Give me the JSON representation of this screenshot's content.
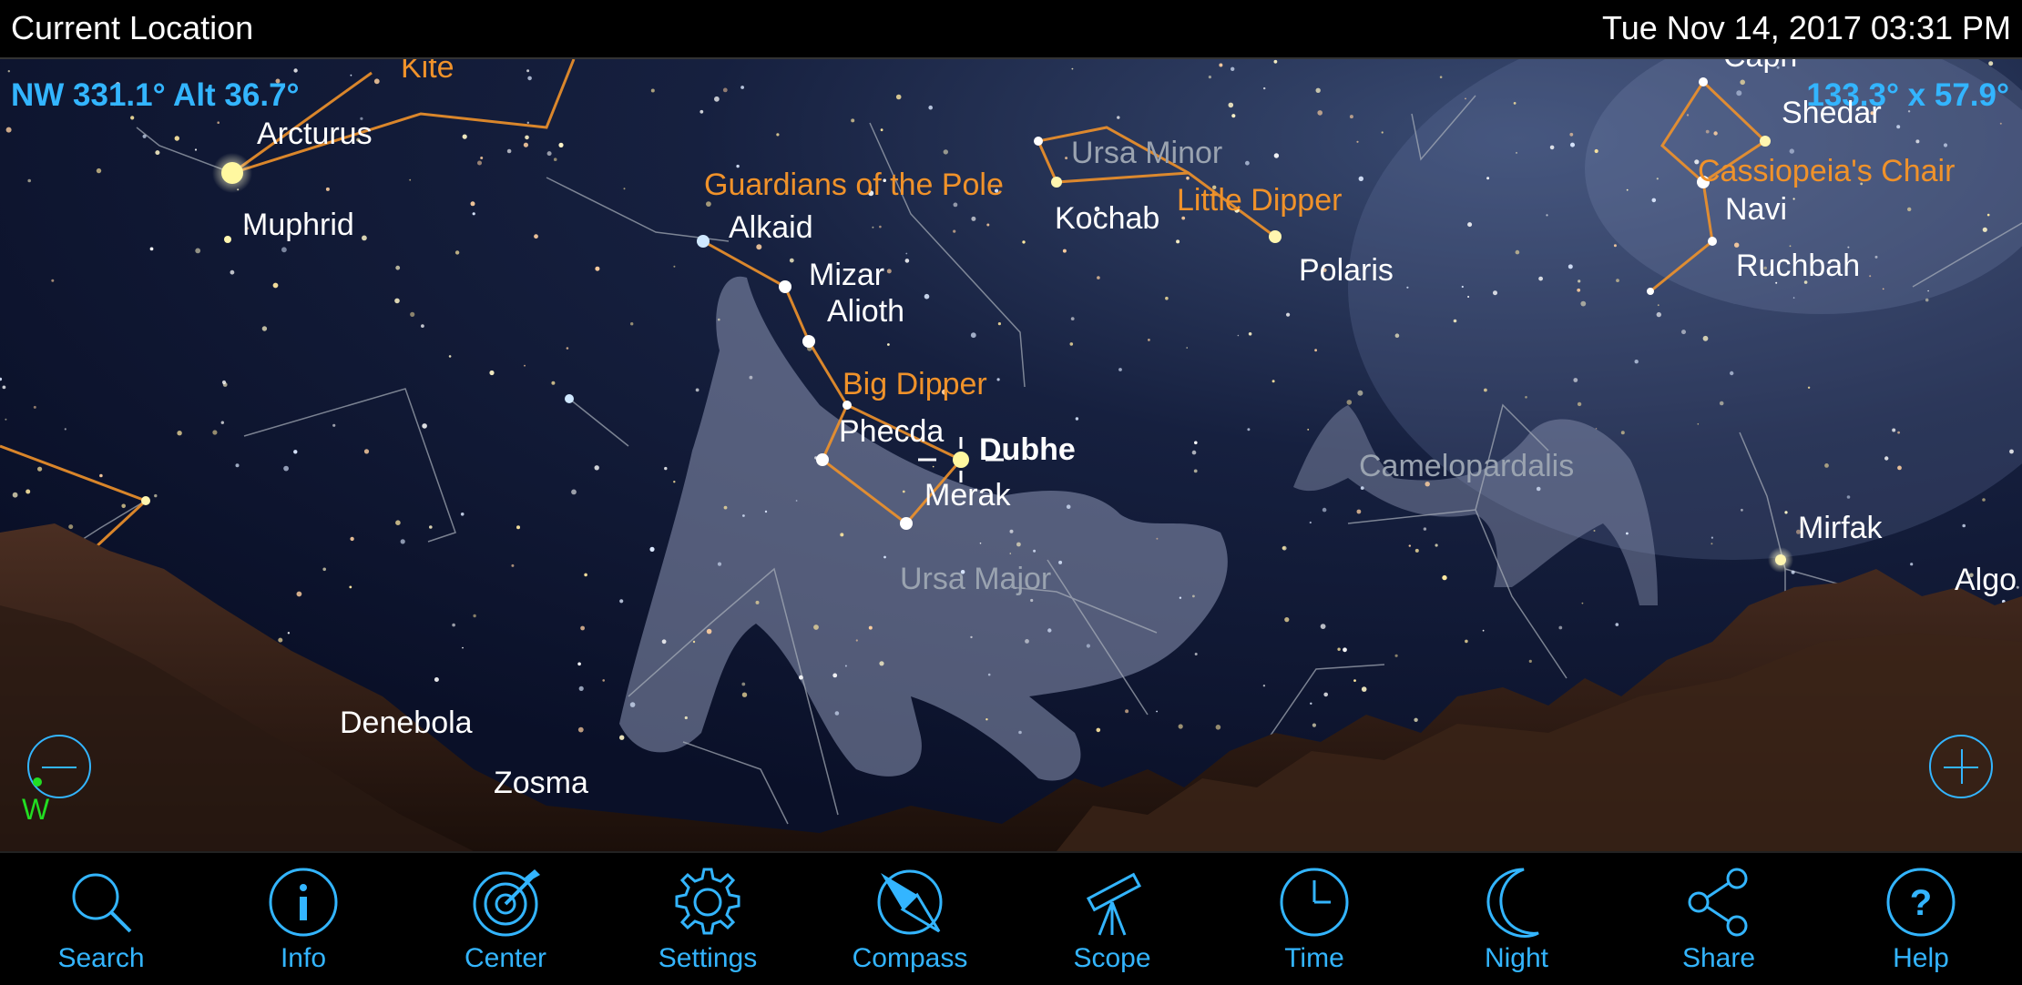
{
  "status_bar": {
    "location": "Current Location",
    "datetime": "Tue Nov 14, 2017  03:31 PM"
  },
  "hud": {
    "direction_readout": "NW 331.1° Alt 36.7°",
    "field_of_view": "133.3° x 57.9°",
    "compass_marker": "W"
  },
  "star_labels": {
    "arcturus": "Arcturus",
    "muphrid": "Muphrid",
    "alkaid": "Alkaid",
    "mizar": "Mizar",
    "alioth": "Alioth",
    "phecda": "Phecda",
    "dubhe": "Dubhe",
    "merak": "Merak",
    "kochab": "Kochab",
    "polaris": "Polaris",
    "shedar": "Shedar",
    "navi": "Navi",
    "ruchbah": "Ruchbah",
    "mirfak": "Mirfak",
    "algol": "Algo",
    "denebola": "Denebola",
    "zosma": "Zosma",
    "caph": "Caph"
  },
  "asterism_labels": {
    "kite": "Kite",
    "guardians": "Guardians of the Pole",
    "little_dipper": "Little Dipper",
    "big_dipper": "Big Dipper",
    "cassiopeias_chair": "Cassiopeia's Chair"
  },
  "constellation_labels": {
    "ursa_minor": "Ursa Minor",
    "ursa_major": "Ursa Major",
    "camelopardalis": "Camelopardalis"
  },
  "colors": {
    "accent": "#33b5ff",
    "asterism": "#f0922a",
    "compass": "#22dd22"
  },
  "toolbar": [
    {
      "label": "Search",
      "icon": "search-icon"
    },
    {
      "label": "Info",
      "icon": "info-icon"
    },
    {
      "label": "Center",
      "icon": "center-target-icon"
    },
    {
      "label": "Settings",
      "icon": "gear-icon"
    },
    {
      "label": "Compass",
      "icon": "compass-icon"
    },
    {
      "label": "Scope",
      "icon": "telescope-icon"
    },
    {
      "label": "Time",
      "icon": "clock-icon"
    },
    {
      "label": "Night",
      "icon": "moon-icon"
    },
    {
      "label": "Share",
      "icon": "share-icon"
    },
    {
      "label": "Help",
      "icon": "help-icon"
    }
  ]
}
